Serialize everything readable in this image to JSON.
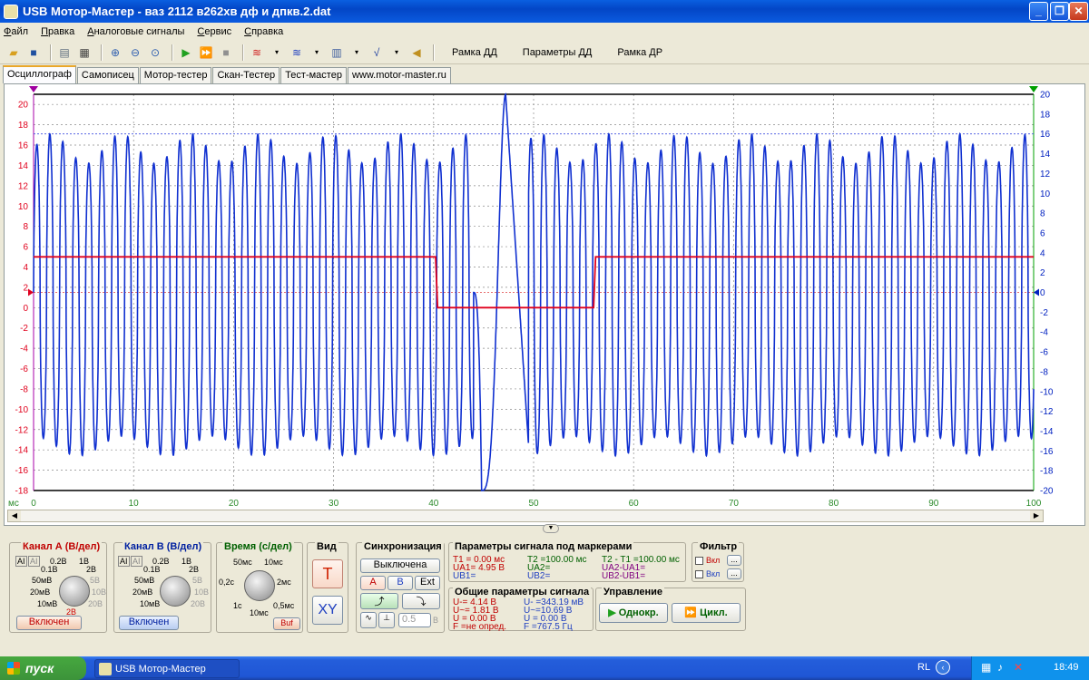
{
  "window": {
    "title": "USB Мотор-Мастер - ваз 2112 в262хв дф и дпкв.2.dat"
  },
  "menu": [
    "Файл",
    "Правка",
    "Аналоговые сигналы",
    "Сервис",
    "Справка"
  ],
  "toolbar": {
    "text_buttons": [
      "Рамка ДД",
      "Параметры ДД",
      "Рамка ДР"
    ]
  },
  "tabs": [
    "Осциллограф",
    "Самописец",
    "Мотор-тестер",
    "Скан-Тестер",
    "Тест-мастер",
    "www.motor-master.ru"
  ],
  "colors": {
    "channel_a": "#e0001c",
    "channel_b": "#1030d0",
    "axis_x": "#2a8a2a",
    "axis_right": "#0020c0"
  },
  "chart_data": {
    "type": "line",
    "x_unit": "мс",
    "xlim": [
      0,
      100
    ],
    "x_ticks": [
      0,
      10,
      20,
      30,
      40,
      50,
      60,
      70,
      80,
      90,
      100
    ],
    "y_left_ticks": [
      20,
      18,
      16,
      14,
      12,
      10,
      8,
      6,
      4,
      2,
      0,
      -2,
      -4,
      -6,
      -8,
      -10,
      -12,
      -14,
      -16,
      -18
    ],
    "y_right_ticks": [
      20,
      18,
      16,
      14,
      12,
      10,
      8,
      6,
      4,
      2,
      0,
      -2,
      -4,
      -6,
      -8,
      -10,
      -12,
      -14,
      -16,
      -18,
      -20
    ],
    "ylim_left": [
      -18,
      21
    ],
    "ylim_right": [
      -20,
      20
    ],
    "series": [
      {
        "axis": "left",
        "color": "#e0001c",
        "x": [
          0,
          40.2,
          40.4,
          56.0,
          56.2,
          100
        ],
        "y": [
          5,
          5,
          0,
          0,
          5,
          5
        ]
      },
      {
        "axis": "right",
        "color": "#1030d0",
        "period_ms": 1.3,
        "amplitude_high": 14.5,
        "amplitude_low": -15.5,
        "gap_start_ms": 44,
        "gap_end_ms": 49.5,
        "spike_min_ms": 44.8,
        "spike_min_v": -20,
        "spike_max_ms": 47.2,
        "spike_max_v": 20
      }
    ],
    "markers": {
      "y_left_level": 1.5,
      "y_right_level": 16,
      "grid": true
    }
  },
  "panel": {
    "channel_a": {
      "title": "Канал А (В/дел)",
      "btn": "Включен",
      "scale": [
        "0.2В",
        "1В",
        "0.1В",
        "2В",
        "50мВ",
        "5В",
        "20мВ",
        "10В",
        "10мВ",
        "20В",
        "2В"
      ]
    },
    "channel_b": {
      "title": "Канал В (В/дел)",
      "btn": "Включен",
      "scale": [
        "0.2В",
        "1В",
        "0.1В",
        "2В",
        "50мВ",
        "5В",
        "20мВ",
        "10В",
        "10мВ",
        "20В"
      ]
    },
    "time": {
      "title": "Время (с/дел)",
      "scale": [
        "50мс",
        "10мс",
        "0,2с",
        "2мс",
        "1с",
        "0,5мс",
        "10мс"
      ],
      "btn": "Buf"
    },
    "view": {
      "title": "Вид",
      "t": "T",
      "xy": "XY"
    },
    "sync": {
      "title": "Синхронизация",
      "state": "Выключена",
      "a": "A",
      "b": "B",
      "ext": "Ext",
      "level": "0.5",
      "unit": "В"
    },
    "markers": {
      "title": "Параметры сигнала под маркерами",
      "col1": [
        "T1 = 0.00 мс",
        "UA1= 4.95 В",
        "UB1="
      ],
      "col2": [
        "T2 =100.00 мс",
        "UA2=",
        "UB2="
      ],
      "col3": [
        "T2 - T1 =100.00 мс",
        "UA2-UA1=",
        "UB2-UB1="
      ]
    },
    "filter": {
      "title": "Фильтр",
      "items": [
        "Вкл",
        "Вкл"
      ],
      "more": "..."
    },
    "common": {
      "title": "Общие параметры сигнала",
      "col1": [
        "U-= 4.14 В",
        "U~= 1.81 В",
        "U = 0.00 В",
        "F =не опред."
      ],
      "col2": [
        "U- =343.19 мВ",
        "U~=10.69 В",
        "U = 0.00 В",
        "F =767.5 Гц"
      ]
    },
    "control": {
      "title": "Управление",
      "single": "Однокр.",
      "cycle": "Цикл."
    }
  },
  "taskbar": {
    "start": "пуск",
    "item": "USB Мотор-Мастер",
    "lang": "RL",
    "time": "18:49"
  }
}
